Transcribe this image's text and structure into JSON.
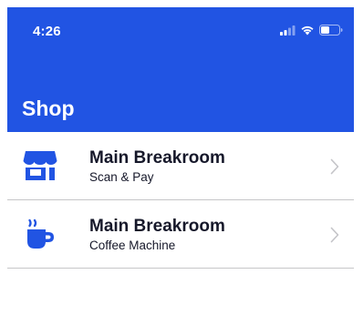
{
  "status_bar": {
    "time": "4:26",
    "signal_icon": "signal-bars-icon",
    "wifi_icon": "wifi-icon",
    "battery_icon": "battery-icon"
  },
  "header": {
    "title": "Shop"
  },
  "colors": {
    "brand": "#2154e3",
    "text": "#16182a",
    "chevron": "#c4c4c8",
    "divider": "#c6c6c8"
  },
  "list": {
    "items": [
      {
        "title": "Main Breakroom",
        "subtitle": "Scan & Pay",
        "icon": "store-icon"
      },
      {
        "title": "Main Breakroom",
        "subtitle": "Coffee Machine",
        "icon": "coffee-cup-icon"
      }
    ]
  }
}
